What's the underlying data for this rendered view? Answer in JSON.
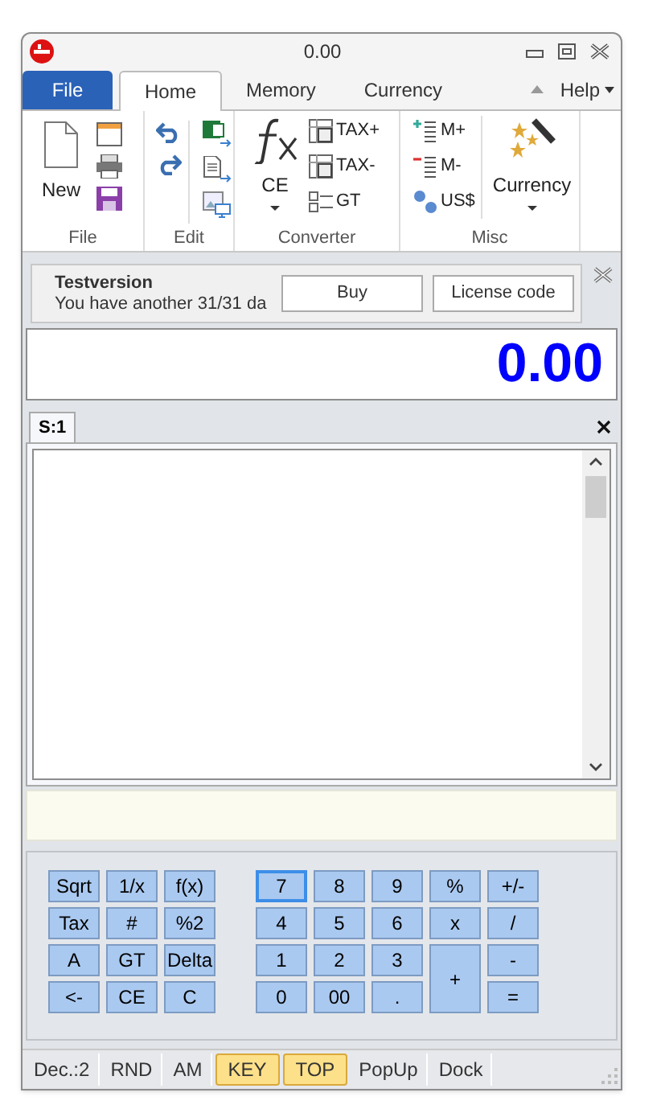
{
  "window": {
    "title": "0.00"
  },
  "menu_tabs": [
    {
      "label": "File",
      "kind": "file",
      "selected": false
    },
    {
      "label": "Home",
      "kind": "tab",
      "selected": true
    },
    {
      "label": "Memory",
      "kind": "tab",
      "selected": false
    },
    {
      "label": "Currency",
      "kind": "tab",
      "selected": false
    }
  ],
  "help_menu": "Help",
  "ribbon": {
    "file_group": {
      "label": "File",
      "new_button": "New"
    },
    "edit_group": {
      "label": "Edit"
    },
    "converter_group": {
      "label": "Converter",
      "large_button": "CE",
      "tax_plus": "TAX+",
      "tax_minus": "TAX-",
      "gt": "GT"
    },
    "misc_group": {
      "label": "Misc",
      "m_plus": "M+",
      "m_minus": "M-",
      "currency_small": "US$",
      "currency_large": "Currency"
    }
  },
  "notice": {
    "title": "Testversion",
    "message": "You have another 31/31 da",
    "buttons": [
      "Buy",
      "License code"
    ]
  },
  "display": "0.00",
  "sheet_tabs": [
    {
      "label": "S:1",
      "selected": true
    }
  ],
  "keypad": {
    "left": [
      {
        "label": "Sqrt",
        "kind": "key",
        "focused": false
      },
      {
        "label": "1/x",
        "kind": "key",
        "focused": false
      },
      {
        "label": "f(x)",
        "kind": "key",
        "focused": false
      },
      {
        "label": "Tax",
        "kind": "key",
        "focused": false
      },
      {
        "label": "#",
        "kind": "key",
        "focused": false
      },
      {
        "label": "%2",
        "kind": "key",
        "focused": false
      },
      {
        "label": "A",
        "kind": "key",
        "focused": false
      },
      {
        "label": "GT",
        "kind": "key",
        "focused": false
      },
      {
        "label": "Delta",
        "kind": "key",
        "focused": false
      },
      {
        "label": "<-",
        "kind": "key",
        "focused": false
      },
      {
        "label": "CE",
        "kind": "key",
        "focused": false
      },
      {
        "label": "C",
        "kind": "key",
        "focused": false
      }
    ],
    "right": [
      {
        "label": "7",
        "kind": "key",
        "focused": true
      },
      {
        "label": "8",
        "kind": "key",
        "focused": false
      },
      {
        "label": "9",
        "kind": "key",
        "focused": false
      },
      {
        "label": "%",
        "kind": "key",
        "focused": false
      },
      {
        "label": "+/-",
        "kind": "key",
        "focused": false
      },
      {
        "label": "4",
        "kind": "key",
        "focused": false
      },
      {
        "label": "5",
        "kind": "key",
        "focused": false
      },
      {
        "label": "6",
        "kind": "key",
        "focused": false
      },
      {
        "label": "x",
        "kind": "key",
        "focused": false
      },
      {
        "label": "/",
        "kind": "key",
        "focused": false
      },
      {
        "label": "1",
        "kind": "key",
        "focused": false
      },
      {
        "label": "2",
        "kind": "key",
        "focused": false
      },
      {
        "label": "3",
        "kind": "key",
        "focused": false
      },
      {
        "label": "+",
        "kind": "tall",
        "focused": false
      },
      {
        "label": "-",
        "kind": "key",
        "focused": false
      },
      {
        "label": "0",
        "kind": "key",
        "focused": false
      },
      {
        "label": "00",
        "kind": "key",
        "focused": false
      },
      {
        "label": ".",
        "kind": "key",
        "focused": false
      },
      {
        "label": "=",
        "kind": "key",
        "focused": false
      }
    ]
  },
  "status_bar": [
    {
      "label": "Dec.:2",
      "highlighted": false
    },
    {
      "label": "RND",
      "highlighted": false
    },
    {
      "label": "AM",
      "highlighted": false
    },
    {
      "label": "KEY",
      "highlighted": true
    },
    {
      "label": "TOP",
      "highlighted": true
    },
    {
      "label": "PopUp",
      "highlighted": false
    },
    {
      "label": "Dock",
      "highlighted": false
    }
  ]
}
